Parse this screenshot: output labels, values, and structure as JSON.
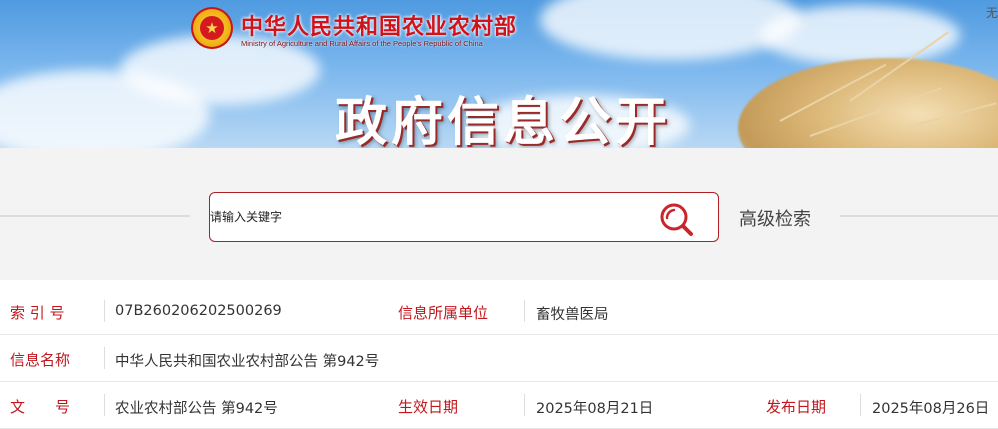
{
  "header": {
    "ministry_name_cn": "中华人民共和国农业农村部",
    "ministry_name_en": "Ministry of Agriculture and Rural Affairs of the People's Republic of China",
    "corner_text": "无",
    "section_title": "政府信息公开",
    "emblem_icon": "national-emblem"
  },
  "search": {
    "placeholder": "请输入关键字",
    "advanced_label": "高级检索",
    "icon": "search-icon"
  },
  "info": {
    "index_no_label": "索 引 号",
    "index_no_value": "07B260206202500269",
    "unit_label": "信息所属单位",
    "unit_value": "畜牧兽医局",
    "name_label": "信息名称",
    "name_value": "中华人民共和国农业农村部公告 第942号",
    "doc_no_label": "文　　号",
    "doc_no_value": "农业农村部公告 第942号",
    "effective_label": "生效日期",
    "effective_value": "2025年08月21日",
    "publish_label": "发布日期",
    "publish_value": "2025年08月26日"
  },
  "colors": {
    "accent": "#c0161c",
    "banner_sky": "#6aaae8"
  }
}
